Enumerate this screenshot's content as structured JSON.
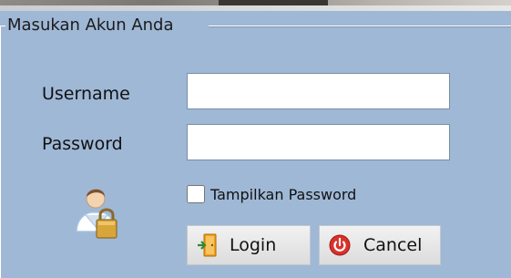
{
  "group": {
    "title": "Masukan Akun Anda"
  },
  "form": {
    "username_label": "Username",
    "username_value": "",
    "password_label": "Password",
    "password_value": "",
    "show_password_label": "Tampilkan Password",
    "show_password_checked": false
  },
  "buttons": {
    "login_label": "Login",
    "login_icon": "door-exit-icon",
    "cancel_label": "Cancel",
    "cancel_icon": "power-icon"
  },
  "icons": {
    "avatar": "user-lock-icon"
  },
  "colors": {
    "panel_bg": "#9fb8d6",
    "cancel_icon_red": "#d9322b",
    "login_icon_orange": "#f0a020"
  }
}
